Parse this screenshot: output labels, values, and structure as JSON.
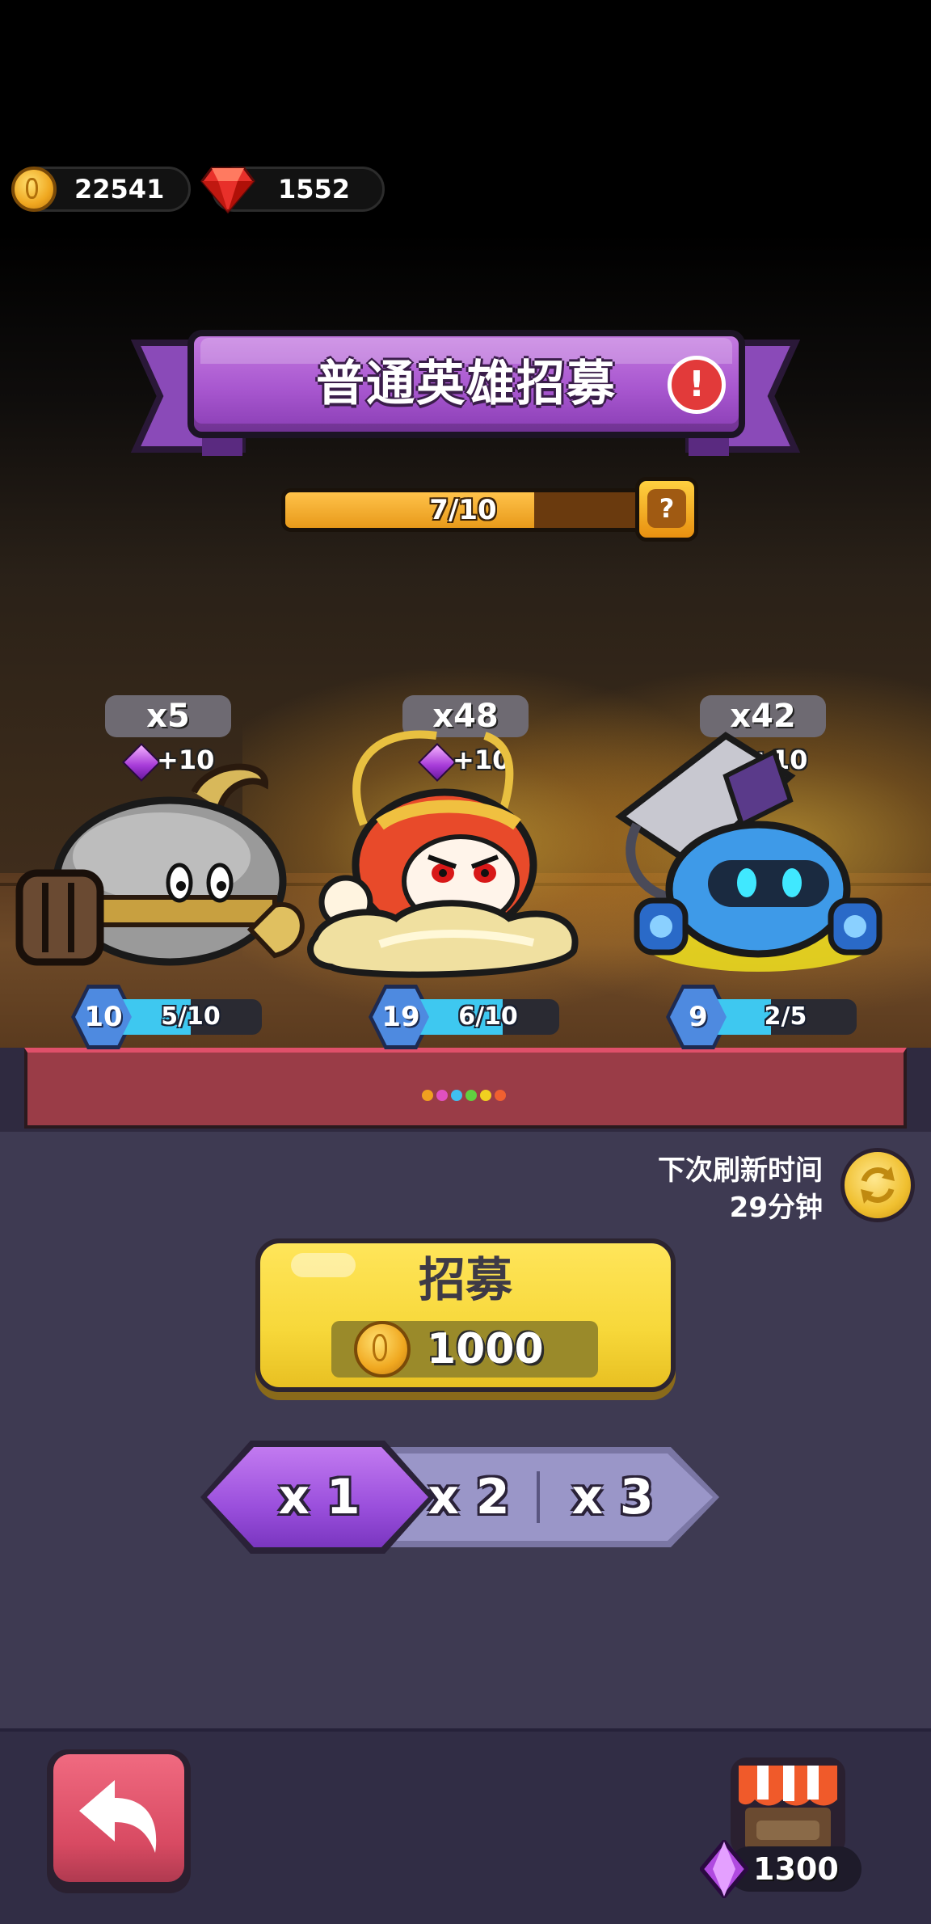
{
  "currency": {
    "gold": "22541",
    "gems": "1552"
  },
  "banner": {
    "title": "普通英雄招募",
    "alert_symbol": "!"
  },
  "progress": {
    "text": "7/10",
    "value": 7,
    "max": 10,
    "help_symbol": "?"
  },
  "heroes": [
    {
      "count": "x5",
      "gem_bonus": "+10",
      "level": "10",
      "xp_text": "5/10",
      "xp_fraction": 0.5
    },
    {
      "count": "x48",
      "gem_bonus": "+10",
      "level": "19",
      "xp_text": "6/10",
      "xp_fraction": 0.6
    },
    {
      "count": "x42",
      "gem_bonus": "+10",
      "level": "9",
      "xp_text": "2/5",
      "xp_fraction": 0.4
    }
  ],
  "page_dots": [
    "#f0a020",
    "#e050c0",
    "#40c0f0",
    "#60d040",
    "#f0d020",
    "#f06030"
  ],
  "refresh": {
    "label": "下次刷新时间",
    "time": "29分钟"
  },
  "recruit": {
    "label": "招募",
    "cost": "1000"
  },
  "multiplier": {
    "options": [
      "x 1",
      "x 2",
      "x 3"
    ],
    "selected": "x 1"
  },
  "shop": {
    "gem_price": "1300"
  },
  "icons": {
    "gold": "gold-coin-icon",
    "gem_red": "red-gem-icon",
    "gem_purple": "purple-gem-icon",
    "back": "back-arrow-icon",
    "refresh": "refresh-icon",
    "shop": "shop-stall-icon"
  },
  "colors": {
    "banner_purple": "#a857cf",
    "recruit_yellow": "#f7d83a",
    "selected_purple": "#9a4fdc",
    "back_red": "#d84a62",
    "xp_cyan": "#3ec8f0"
  }
}
